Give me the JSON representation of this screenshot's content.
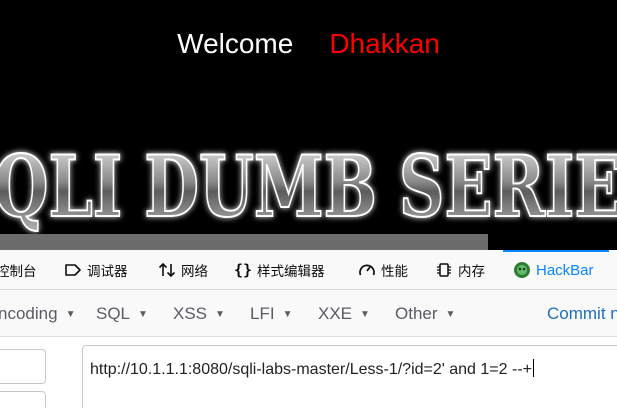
{
  "page": {
    "welcome_label": "Welcome",
    "welcome_name": "Dhakkan",
    "banner_text": "SQLI DUMB SERIES"
  },
  "devtools": {
    "tabs": [
      {
        "label": "控制台",
        "icon": "console-icon"
      },
      {
        "label": "调试器",
        "icon": "debugger-icon"
      },
      {
        "label": "网络",
        "icon": "network-icon"
      },
      {
        "label": "样式编辑器",
        "icon": "style-editor-icon"
      },
      {
        "label": "性能",
        "icon": "performance-icon"
      },
      {
        "label": "内存",
        "icon": "memory-icon"
      },
      {
        "label": "HackBar",
        "icon": "hackbar-icon",
        "active": true
      }
    ]
  },
  "hackbar": {
    "menus": [
      {
        "label": "ncoding"
      },
      {
        "label": "SQL"
      },
      {
        "label": "XSS"
      },
      {
        "label": "LFI"
      },
      {
        "label": "XXE"
      },
      {
        "label": "Other"
      }
    ],
    "commit_label": "Commit n",
    "url_value": "http://10.1.1.1:8080/sqli-labs-master/Less-1/?id=2' and 1=2 --+"
  },
  "colors": {
    "welcome": "#ffffff",
    "name": "#ff0000",
    "active_tab": "#0a84ff",
    "commit": "#1f6fb8"
  }
}
